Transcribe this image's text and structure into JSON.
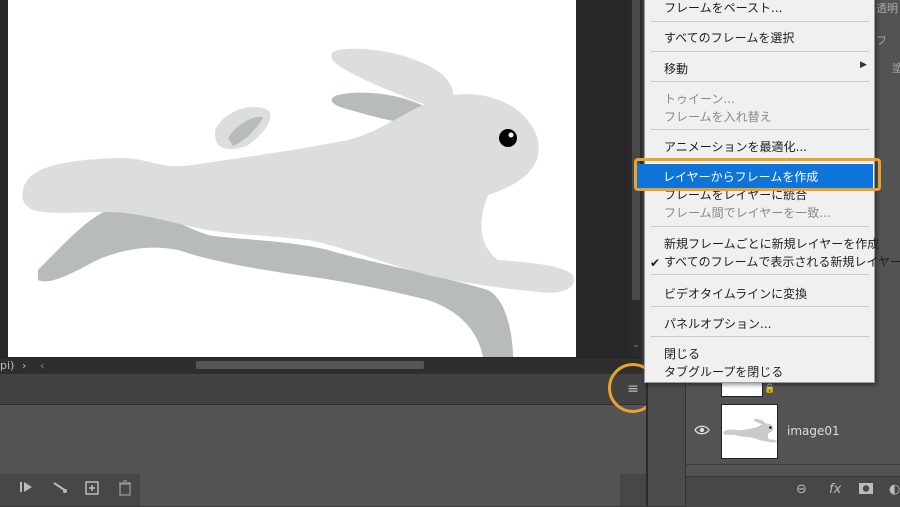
{
  "status_bar": {
    "zoom_suffix": "pi)",
    "next_arrow": "›",
    "prev_arrow": "‹"
  },
  "timeline": {
    "menu_icon": "≡"
  },
  "layers": {
    "top_labels": [
      "透明",
      "フ",
      "塗"
    ],
    "layer_name": "image01"
  },
  "menu": {
    "items": [
      {
        "label": "フレームをペースト...",
        "disabled": false
      },
      {
        "label": "すべてのフレームを選択",
        "disabled": false
      },
      {
        "label": "移動",
        "disabled": false
      },
      {
        "label": "トゥイーン...",
        "disabled": true
      },
      {
        "label": "フレームを入れ替え",
        "disabled": true
      },
      {
        "label": "アニメーションを最適化...",
        "disabled": false
      },
      {
        "label": "レイヤーからフレームを作成",
        "disabled": false,
        "highlighted": true
      },
      {
        "label": "フレームをレイヤーに統合",
        "disabled": false
      },
      {
        "label": "フレーム間でレイヤーを一致...",
        "disabled": true
      },
      {
        "label": "新規フレームごとに新規レイヤーを作成",
        "disabled": false
      },
      {
        "label": "すべてのフレームで表示される新規レイヤー",
        "disabled": false,
        "checked": true
      },
      {
        "label": "ビデオタイムラインに変換",
        "disabled": false
      },
      {
        "label": "パネルオプション...",
        "disabled": false
      },
      {
        "label": "閉じる",
        "disabled": false
      },
      {
        "label": "タブグループを閉じる",
        "disabled": false
      }
    ]
  },
  "colors": {
    "highlight_outline": "#e8a230",
    "menu_selection": "#0f74d9"
  }
}
